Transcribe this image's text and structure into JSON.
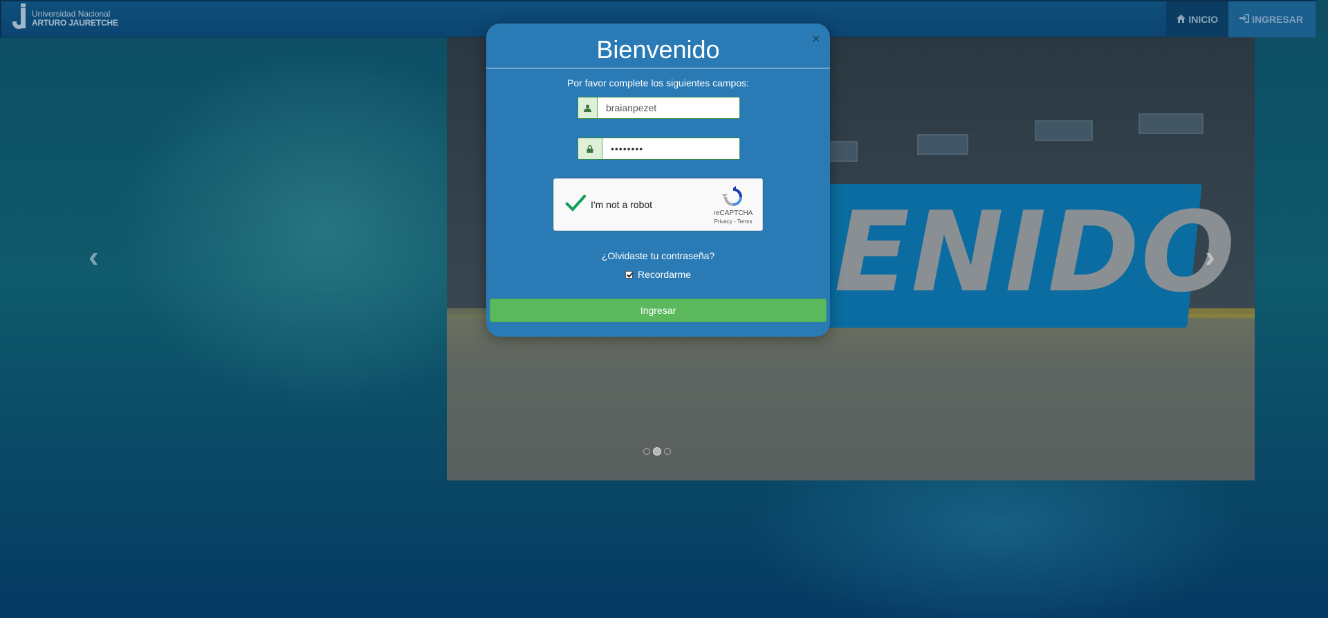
{
  "navbar": {
    "brand_line1": "Universidad Nacional",
    "brand_line2": "ARTURO JAURETCHE",
    "items": [
      {
        "label": "INICIO",
        "icon": "home-icon"
      },
      {
        "label": "INGRESAR",
        "icon": "log-in-icon"
      }
    ]
  },
  "carousel": {
    "banner_text": "ENIDO",
    "prev_symbol": "‹",
    "next_symbol": "›",
    "indicator_count": 3,
    "active_indicator": 1
  },
  "modal": {
    "title": "Bienvenido",
    "close_symbol": "×",
    "subtitle": "Por favor complete los siguientes campos:",
    "username_value": "braianpezet",
    "password_value": "••••••••",
    "captcha": {
      "label": "I'm not a robot",
      "checked": true,
      "brand": "reCAPTCHA",
      "links": "Privacy - Terms"
    },
    "forgot_link": "¿Olvidaste tu contraseña?",
    "remember_label": "Recordarme",
    "remember_checked": true,
    "submit_label": "Ingresar"
  },
  "colors": {
    "modal_bg": "#2a7bb5",
    "submit_bg": "#5cb85c",
    "navbar_bg": "#0e4f7c",
    "banner_bg": "#0a6ca0"
  }
}
